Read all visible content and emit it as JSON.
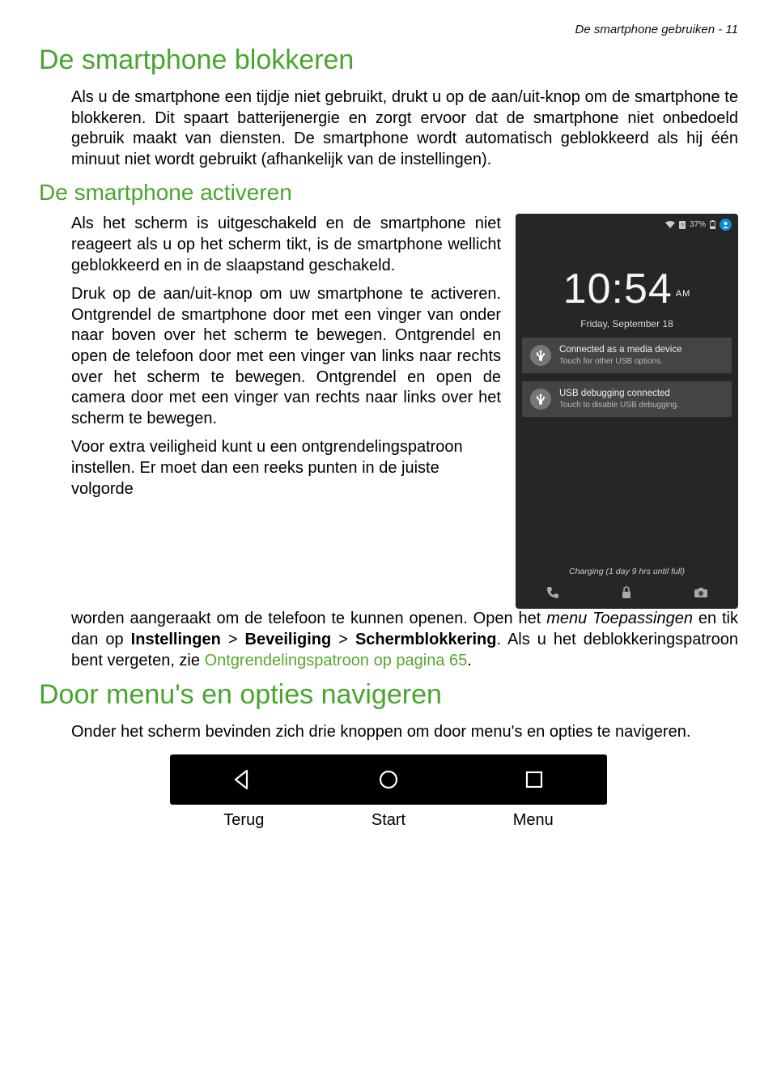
{
  "header": {
    "running": "De smartphone gebruiken - 11"
  },
  "h1_blokkeren": "De smartphone blokkeren",
  "p_blokkeren": "Als u de smartphone een tijdje niet gebruikt, drukt u op de aan/uit-knop om de smartphone te blokkeren. Dit spaart batterijenergie en zorgt ervoor dat de smartphone niet onbedoeld gebruik maakt van diensten. De smartphone wordt automatisch geblokkeerd als hij één minuut niet wordt gebruikt (afhankelijk van de instellingen).",
  "h2_activeren": "De smartphone activeren",
  "p_act_1": "Als het scherm is uitgeschakeld en de smartphone niet reageert als u op het scherm tikt, is de smartphone wellicht geblokkeerd en in de slaapstand geschakeld.",
  "p_act_2": "Druk op de aan/uit-knop om uw smartphone te activeren. Ontgrendel de smartphone door met een vinger van onder naar boven over het scherm te bewegen. Ontgrendel en open de telefoon door met een vinger van links naar rechts over het scherm te bewegen. Ontgrendel en open de camera door met een vinger van rechts naar links over het scherm te bewegen.",
  "p_act_3a": "Voor extra veiligheid kunt u een ontgrendelingspatroon instellen. Er moet dan een reeks punten in de juiste volgorde",
  "p_act_3b_1": "worden aangeraakt om de telefoon te kunnen openen. Open het ",
  "p_act_3b_menu": "menu Toepassingen",
  "p_act_3b_2": " en tik dan op ",
  "p_act_3b_inst": "Instellingen",
  "p_act_3b_gt1": " > ",
  "p_act_3b_bev": "Beveiliging",
  "p_act_3b_gt2": " > ",
  "p_act_3b_scherm": "Schermblokkering",
  "p_act_3b_3": ". Als u het deblokkeringspatroon bent vergeten, zie ",
  "p_act_3b_link": "Ontgrendelingspatroon op pagina 65",
  "p_act_3b_4": ".",
  "h1_navigeren": "Door menu's en opties navigeren",
  "p_nav": "Onder het scherm bevinden zich drie knoppen om door menu's en opties te navigeren.",
  "navlabels": {
    "back": "Terug",
    "home": "Start",
    "menu": "Menu"
  },
  "phone": {
    "battery_pct": "37%",
    "time": "10:54",
    "ampm": "AM",
    "date": "Friday, September 18",
    "notif1_t1": "Connected as a media device",
    "notif1_t2": "Touch for other USB options.",
    "notif2_t1": "USB debugging connected",
    "notif2_t2": "Touch to disable USB debugging.",
    "charging": "Charging (1 day 9 hrs until full)"
  }
}
